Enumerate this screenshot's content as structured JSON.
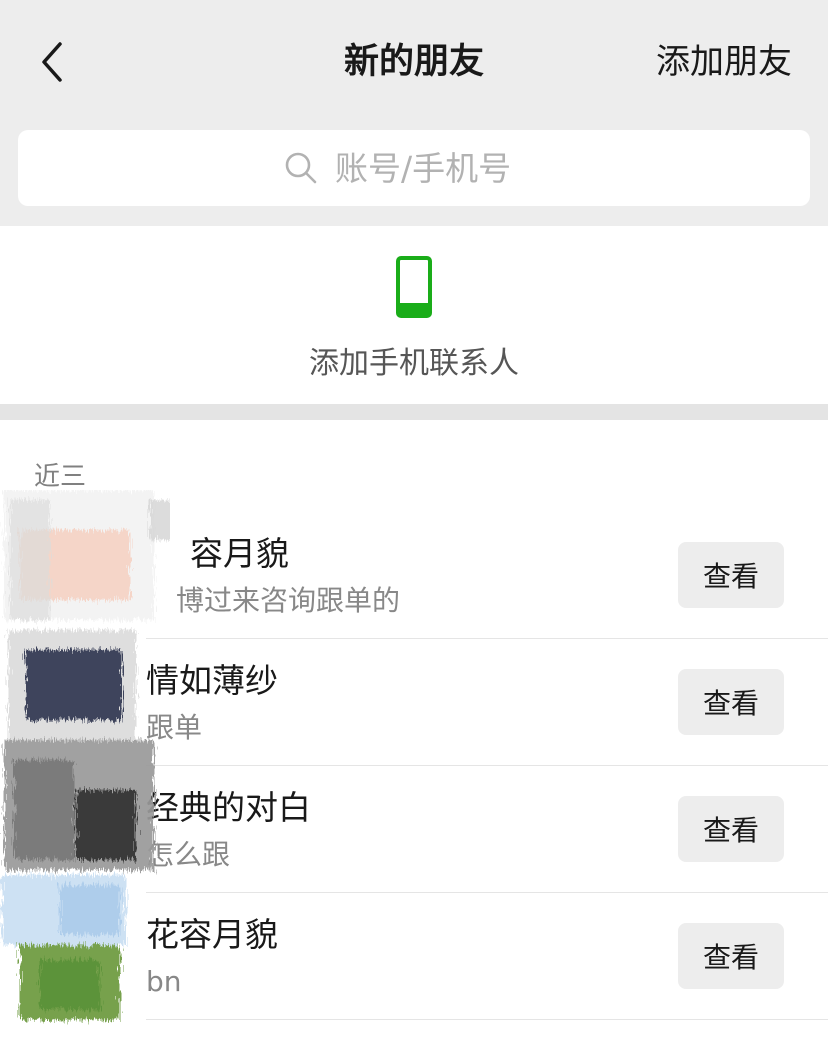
{
  "header": {
    "title": "新的朋友",
    "add_friend": "添加朋友",
    "back_icon": "chevron-left-icon"
  },
  "search": {
    "placeholder": "账号/手机号",
    "icon": "search-icon"
  },
  "phone_contacts": {
    "icon": "phone-icon",
    "label": "添加手机联系人",
    "icon_color": "#1aad19"
  },
  "recent": {
    "section_label": "近三",
    "items": [
      {
        "name": "容月貌",
        "message": "博过来咨询跟单的",
        "button": "查看"
      },
      {
        "name": "情如薄纱",
        "message": "跟单",
        "button": "查看"
      },
      {
        "name": "经典的对白",
        "message": "怎么跟",
        "button": "查看"
      },
      {
        "name": "花容月貌",
        "message": "bn",
        "button": "查看"
      }
    ]
  },
  "colors": {
    "background": "#ededed",
    "surface": "#ffffff",
    "accent": "#1aad19",
    "text_primary": "#191919",
    "text_secondary": "#888888"
  }
}
